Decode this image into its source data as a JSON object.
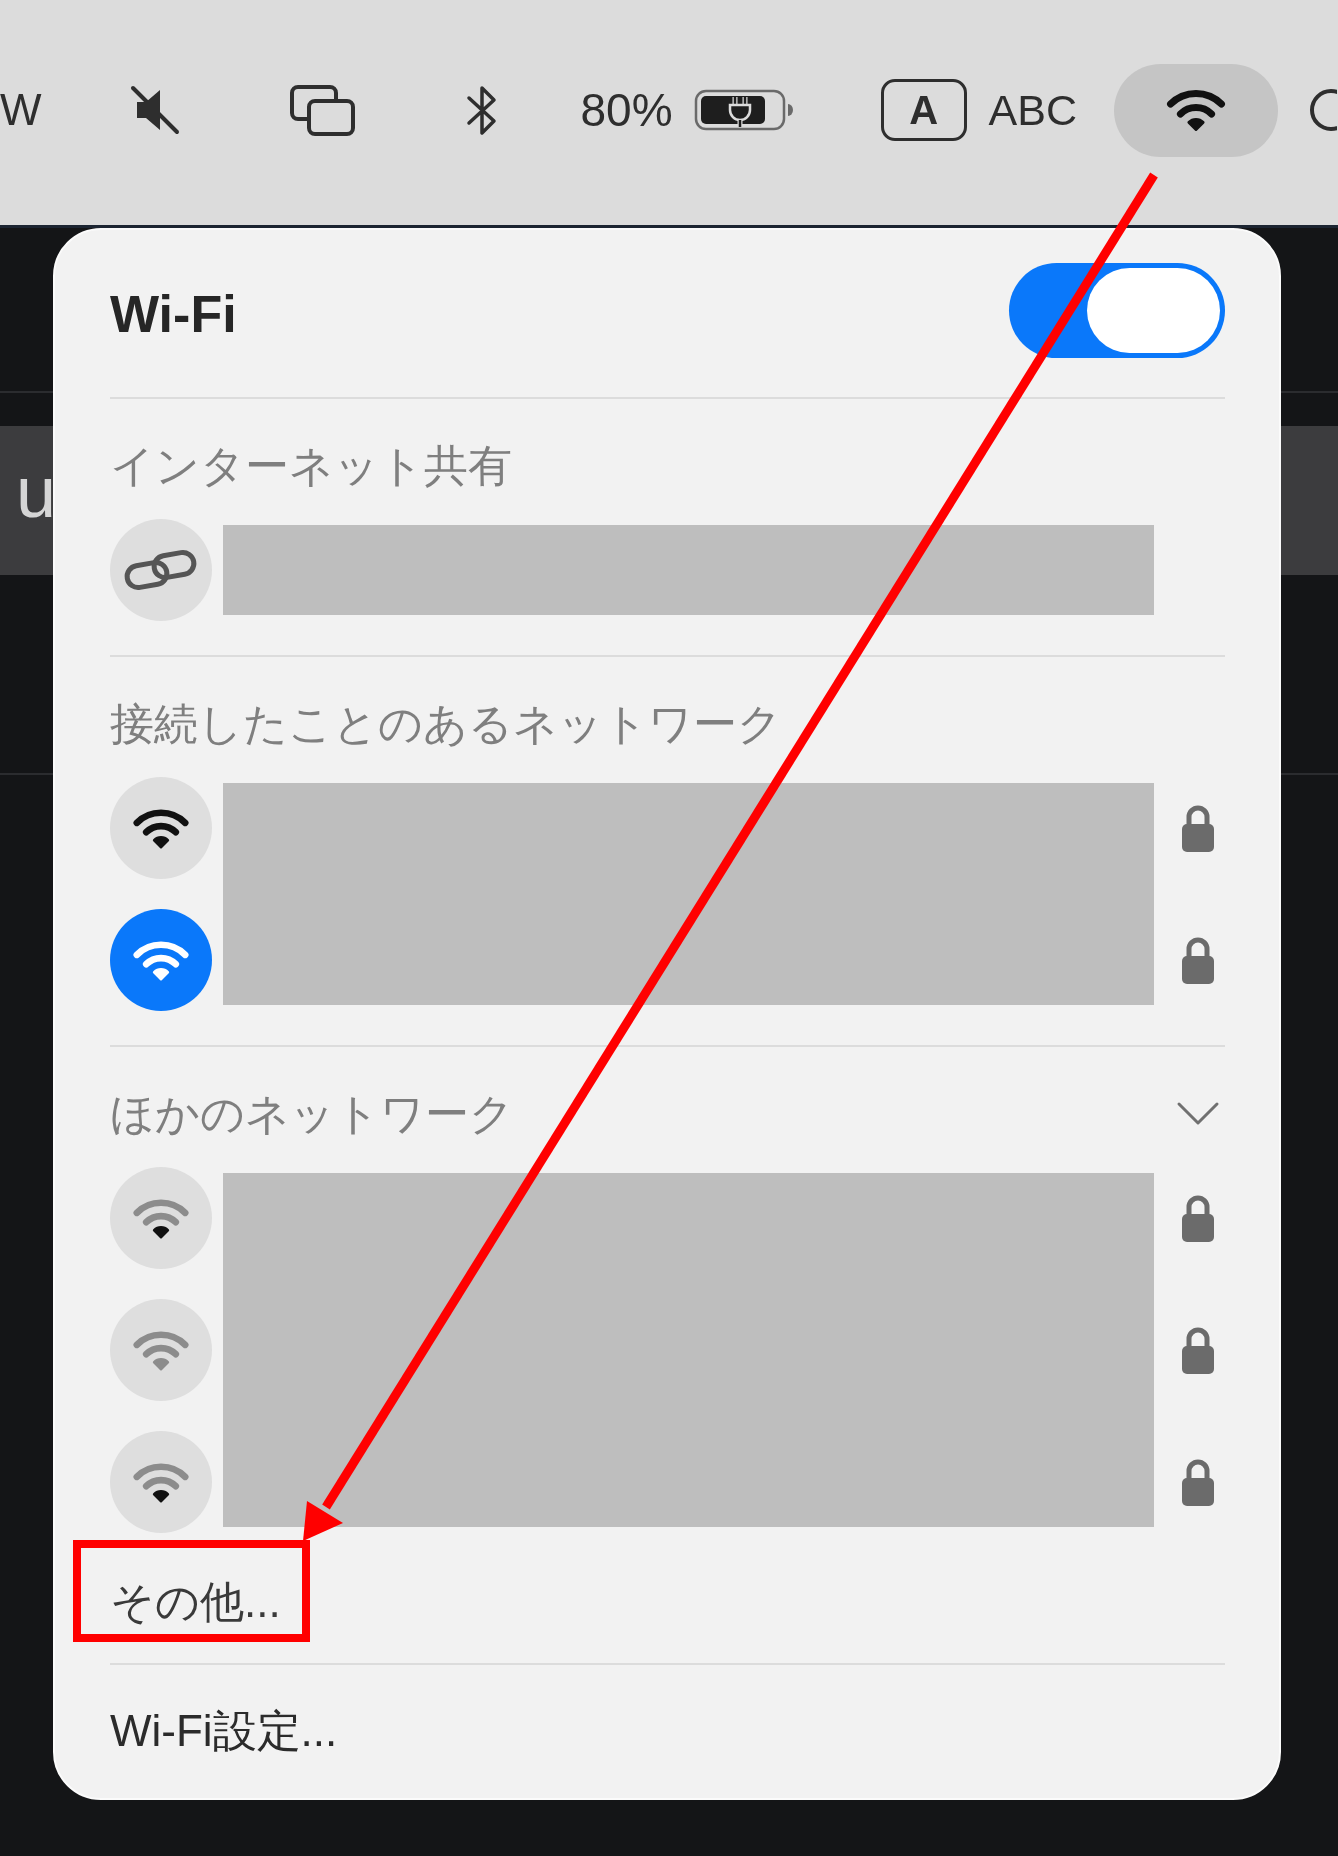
{
  "menu_bar": {
    "left_text": "W",
    "battery_percent": "80%",
    "input_badge": "A",
    "input_source": "ABC",
    "wifi_button": {
      "selected": true
    }
  },
  "background": {
    "text": "u"
  },
  "wifi_panel": {
    "title": "Wi-Fi",
    "toggle": {
      "on": true
    },
    "sections": [
      {
        "heading": "インターネット共有",
        "names_redacted": true,
        "items": [
          {
            "kind": "hotspot",
            "locked": false
          }
        ]
      },
      {
        "heading": "接続したことのあるネットワーク",
        "names_redacted": true,
        "items": [
          {
            "kind": "network",
            "connected": false,
            "weak_signal": false,
            "dimmed": false,
            "locked": true
          },
          {
            "kind": "network",
            "connected": true,
            "weak_signal": false,
            "dimmed": false,
            "locked": true
          }
        ]
      },
      {
        "heading": "ほかのネットワーク",
        "disclosure": {
          "expanded": true
        },
        "names_redacted": true,
        "items": [
          {
            "kind": "network",
            "connected": false,
            "weak_signal": true,
            "dimmed": false,
            "locked": true
          },
          {
            "kind": "network",
            "connected": false,
            "weak_signal": true,
            "dimmed": true,
            "locked": true
          },
          {
            "kind": "network",
            "connected": false,
            "weak_signal": true,
            "dimmed": false,
            "locked": true
          }
        ]
      }
    ],
    "other_item": {
      "label": "その他...",
      "highlighted": true
    },
    "settings_item": {
      "label": "Wi-Fi設定..."
    }
  },
  "annotations": [
    {
      "kind": "arrow"
    }
  ]
}
